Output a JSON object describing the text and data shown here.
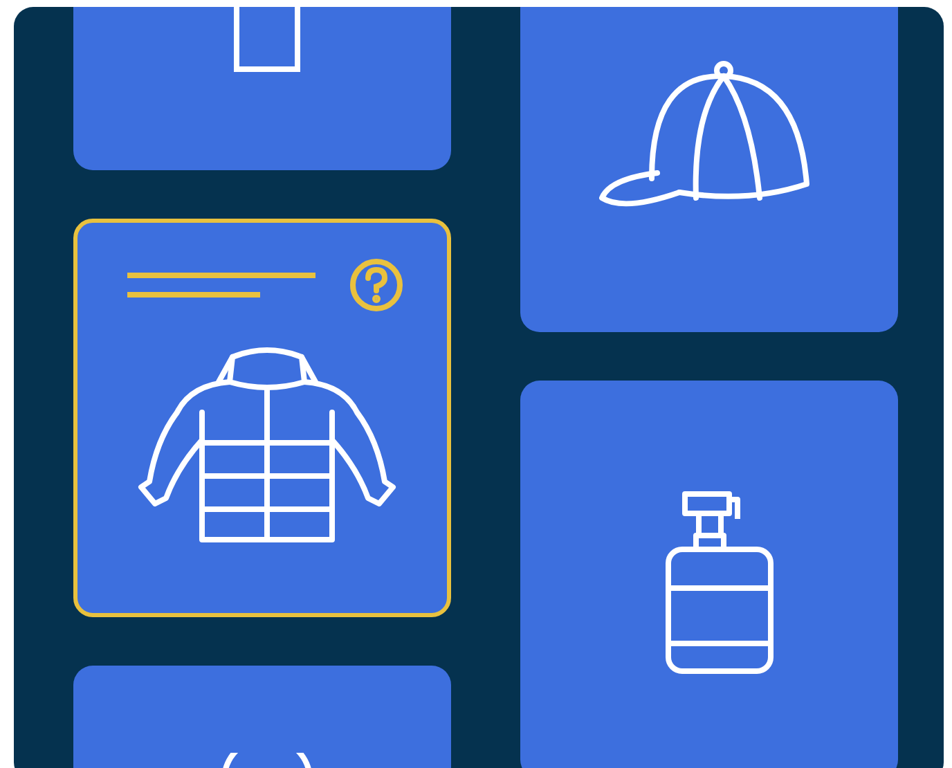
{
  "columns": [
    {
      "cards": [
        {
          "kind": "garment",
          "selected": false
        },
        {
          "kind": "jacket",
          "selected": true
        },
        {
          "kind": "round",
          "selected": false
        }
      ]
    },
    {
      "cards": [
        {
          "kind": "cap",
          "selected": false
        },
        {
          "kind": "bottle",
          "selected": false
        }
      ]
    }
  ]
}
